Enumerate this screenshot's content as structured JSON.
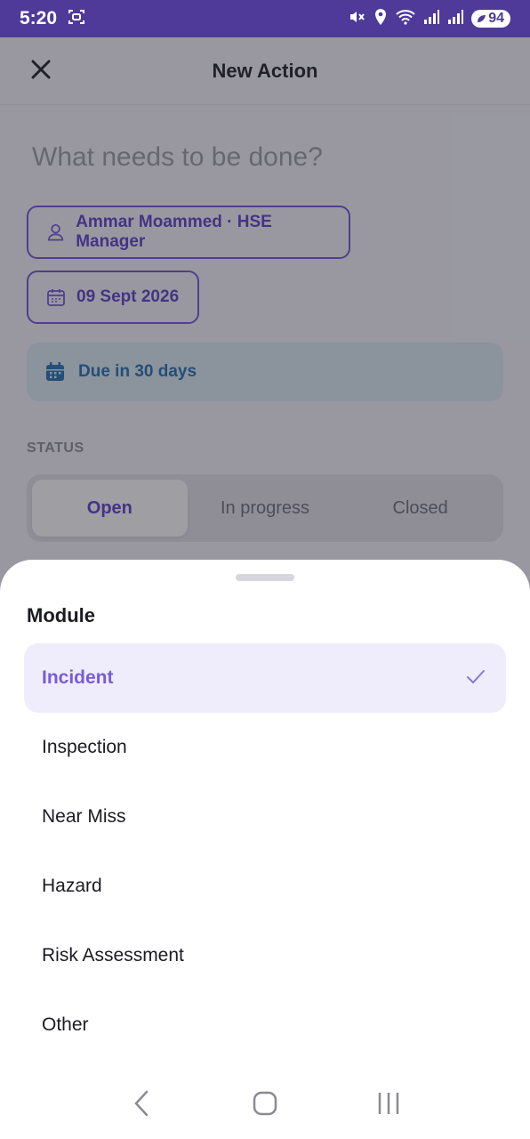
{
  "status_bar": {
    "time": "5:20",
    "battery": "94"
  },
  "header": {
    "title": "New Action"
  },
  "form": {
    "title_placeholder": "What needs to be done?",
    "assignee": "Ammar Moammed · HSE Manager",
    "due_date": "09 Sept 2026",
    "due_notice": "Due in 30 days",
    "status_label": "STATUS",
    "status_options": [
      "Open",
      "In progress",
      "Closed"
    ],
    "status_selected": "Open"
  },
  "sheet": {
    "title": "Module",
    "options": [
      "Incident",
      "Inspection",
      "Near Miss",
      "Hazard",
      "Risk Assessment",
      "Other"
    ],
    "selected": "Incident"
  },
  "colors": {
    "accent": "#6f52d9",
    "status_bar": "#4f3a9a",
    "due_bg": "#dcebf4",
    "due_text": "#1f6fb0"
  }
}
